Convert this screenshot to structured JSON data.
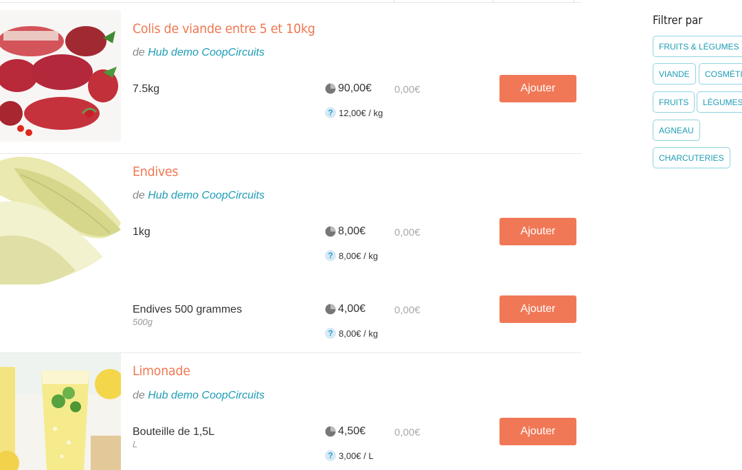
{
  "products": [
    {
      "title": "Colis de viande entre 5 et 10kg",
      "producer_prefix": "de",
      "producer": "Hub demo CoopCircuits",
      "variants": [
        {
          "name": "7.5kg",
          "sub": "",
          "price": "90,00€",
          "qty_price": "0,00€",
          "unit_price": "12,00€ / kg",
          "button": "Ajouter"
        }
      ]
    },
    {
      "title": "Endives",
      "producer_prefix": "de",
      "producer": "Hub demo CoopCircuits",
      "variants": [
        {
          "name": "1kg",
          "sub": "",
          "price": "8,00€",
          "qty_price": "0,00€",
          "unit_price": "8,00€ / kg",
          "button": "Ajouter"
        },
        {
          "name": "Endives 500 grammes",
          "sub": "500g",
          "price": "4,00€",
          "qty_price": "0,00€",
          "unit_price": "8,00€ / kg",
          "button": "Ajouter"
        }
      ]
    },
    {
      "title": "Limonade",
      "producer_prefix": "de",
      "producer": "Hub demo CoopCircuits",
      "variants": [
        {
          "name": "Bouteille de 1,5L",
          "sub": "L",
          "price": "4,50€",
          "qty_price": "0,00€",
          "unit_price": "3,00€ / L",
          "button": "Ajouter"
        }
      ]
    }
  ],
  "filters": {
    "title": "Filtrer par",
    "tags": [
      "FRUITS & LÉGUMES",
      "VIANDE",
      "COSMÉTIQUES",
      "FRUITS",
      "LÉGUMES",
      "AGNEAU",
      "CHARCUTERIES"
    ]
  },
  "colors": {
    "accent": "#f07856",
    "link": "#1c9cb5",
    "title": "#ef7751"
  },
  "icons": {
    "price": "pie-chart-icon",
    "unit_price": "question-mark-icon"
  }
}
